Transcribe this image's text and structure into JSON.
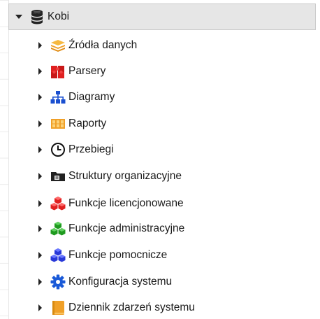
{
  "tree": {
    "root": {
      "label": "Kobi",
      "icon": "database-icon",
      "expanded": true
    },
    "children": [
      {
        "label": "Źródła danych",
        "icon": "stacked-layers-icon",
        "color": "#f0a028"
      },
      {
        "label": "Parsery",
        "icon": "puzzle-icon",
        "color": "#e02020"
      },
      {
        "label": "Diagramy",
        "icon": "hierarchy-icon",
        "color": "#1a4fd0"
      },
      {
        "label": "Raporty",
        "icon": "report-grid-icon",
        "color": "#f0a028"
      },
      {
        "label": "Przebiegi",
        "icon": "clock-icon",
        "color": "#111111"
      },
      {
        "label": "Struktury organizacyjne",
        "icon": "folder-icon",
        "color": "#222222"
      },
      {
        "label": "Funkcje licencjonowane",
        "icon": "cubes-icon",
        "color": "#e02020"
      },
      {
        "label": "Funkcje administracyjne",
        "icon": "cubes-icon",
        "color": "#1f9a1f"
      },
      {
        "label": "Funkcje pomocnicze",
        "icon": "cubes-icon",
        "color": "#2838d8"
      },
      {
        "label": "Konfiguracja systemu",
        "icon": "gear-icon",
        "color": "#1a5ad8"
      },
      {
        "label": "Dziennik zdarzeń systemu",
        "icon": "book-icon",
        "color": "#f0a028"
      }
    ]
  }
}
